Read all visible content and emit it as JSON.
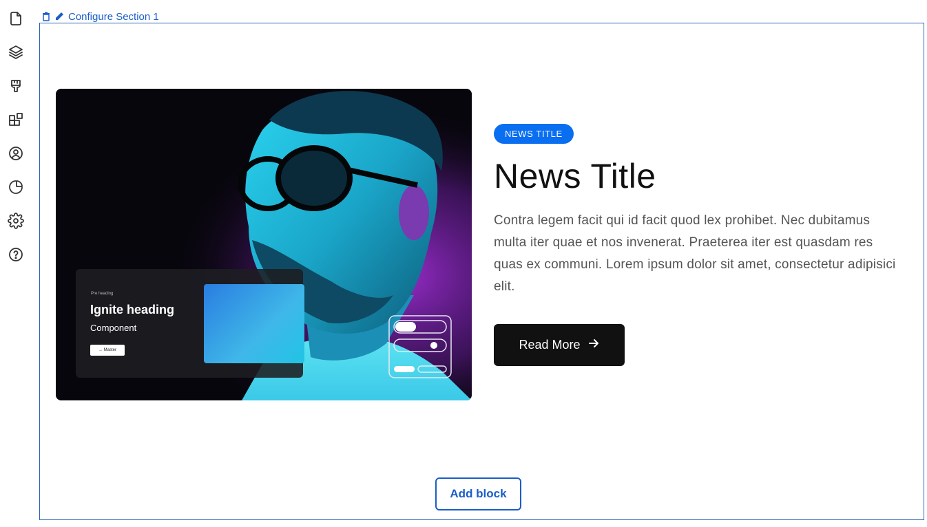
{
  "rail": {
    "icons": [
      "file-icon",
      "layers-icon",
      "brush-icon",
      "blocks-icon",
      "user-circle-icon",
      "pie-chart-icon",
      "gear-icon",
      "help-icon"
    ]
  },
  "toolbar": {
    "delete_icon": "trash-icon",
    "edit_icon": "pencil-icon",
    "configure_label": "Configure Section 1"
  },
  "hero": {
    "card": {
      "pre_heading": "Pre heading",
      "heading": "Ignite heading",
      "component": "Component",
      "button_label": "Master"
    }
  },
  "content": {
    "badge": "NEWS TITLE",
    "title": "News Title",
    "description": "Contra legem facit qui id facit quod lex prohibet. Nec dubitamus multa iter quae et nos invenerat. Praeterea iter est quasdam res quas ex communi. Lorem ipsum dolor sit amet, consectetur adipisici elit.",
    "read_more": "Read More"
  },
  "add_block": "Add block",
  "colors": {
    "accent": "#1a5dc8",
    "badge": "#0a6ef0",
    "button": "#111111"
  }
}
